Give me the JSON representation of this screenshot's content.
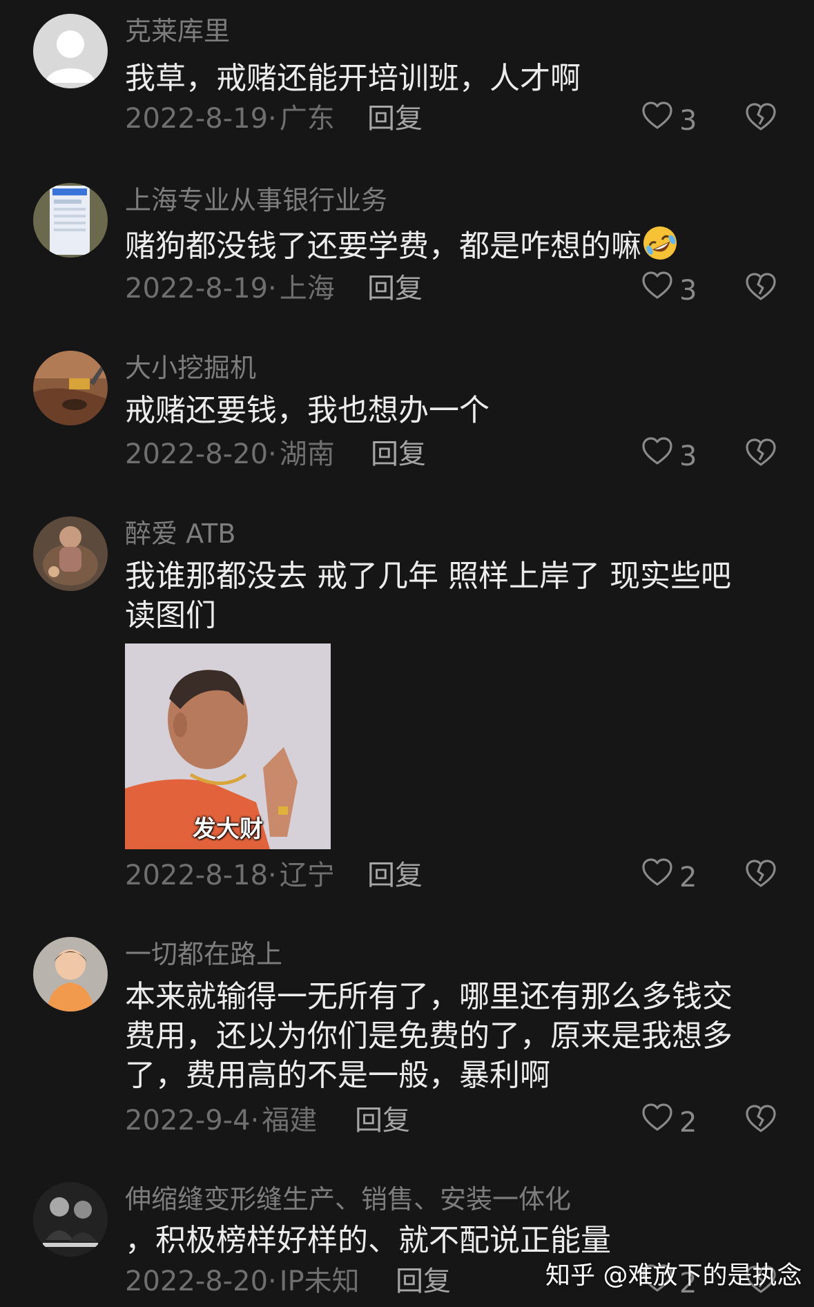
{
  "comments": [
    {
      "username": "克莱库里",
      "text": "我草，戒赌还能开培训班，人才啊",
      "date": "2022-8-19",
      "sep": "·",
      "location": "广东",
      "reply": "回复",
      "likes": "3"
    },
    {
      "username": "上海专业从事银行业务",
      "text": "赌狗都没钱了还要学费，都是咋想的嘛",
      "emoji": "rolling-on-floor-laughing-emoji",
      "date": "2022-8-19",
      "sep": "·",
      "location": "上海",
      "reply": "回复",
      "likes": "3"
    },
    {
      "username": "大小挖掘机",
      "text": "戒赌还要钱，我也想办一个",
      "date": "2022-8-20",
      "sep": "·",
      "location": "湖南",
      "reply": "回复",
      "likes": "3"
    },
    {
      "username": "醉爱 ATB",
      "text": "我谁那都没去 戒了几年 照样上岸了 现实些吧 读图们",
      "sticker_caption": "发大财",
      "date": "2022-8-18",
      "sep": "·",
      "location": "辽宁",
      "reply": "回复",
      "likes": "2"
    },
    {
      "username": "一切都在路上",
      "text": "本来就输得一无所有了，哪里还有那么多钱交费用，还以为你们是免费的了，原来是我想多了，费用高的不是一般，暴利啊",
      "date": "2022-9-4",
      "sep": "·",
      "location": "福建",
      "reply": "回复",
      "likes": "2"
    },
    {
      "username": "伸缩缝变形缝生产、销售、安装一体化",
      "text": "，积极榜样好样的、就不配说正能量",
      "date": "2022-8-20",
      "sep": "·",
      "location": "IP未知",
      "reply": "回复",
      "likes": "2"
    }
  ],
  "watermark": "知乎 @难放下的是执念",
  "icons": {
    "like": "heart-outline-icon",
    "dislike": "broken-heart-icon"
  },
  "colors": {
    "background": "#161616",
    "username": "#7d7d7d",
    "text": "#ececec",
    "meta": "#6f6f6f"
  }
}
